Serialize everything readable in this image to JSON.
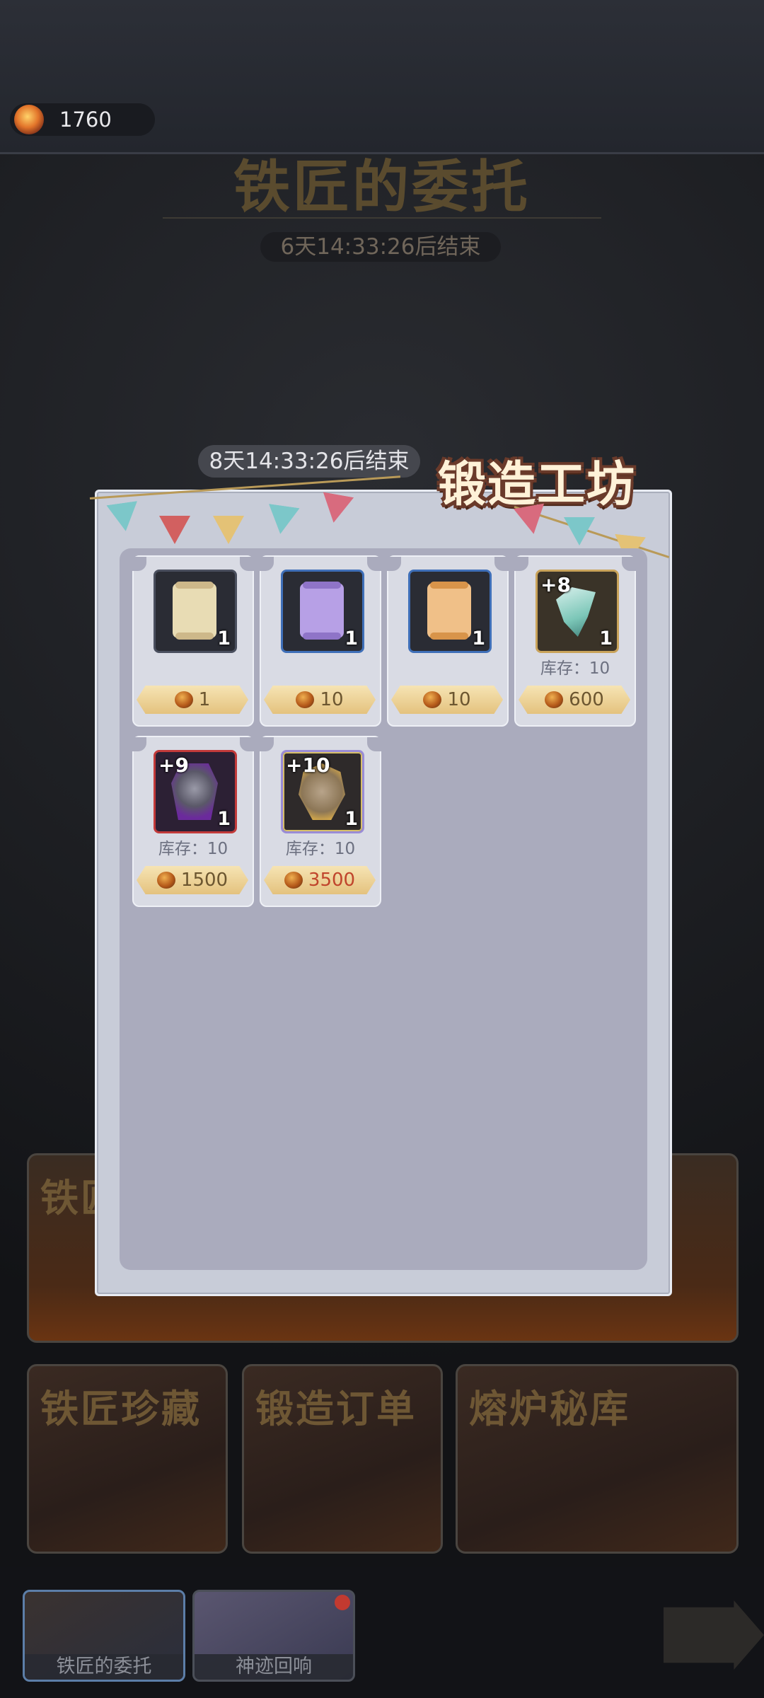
{
  "currency": {
    "amount": "1760",
    "icon": "ore-icon"
  },
  "background": {
    "title": "铁匠的委托",
    "timer": "6天14:33:26后结束",
    "banner_main": "铁匠",
    "banners": [
      "铁匠珍藏",
      "锻造订单",
      "熔炉秘库"
    ],
    "bottom_tabs": [
      "铁匠的委托",
      "神迹回响"
    ]
  },
  "forge": {
    "title": "锻造工坊",
    "timer": "8天14:33:26后结束",
    "items": [
      {
        "name": "white-scroll",
        "count": "1",
        "plus": "",
        "stock": "",
        "price": "1",
        "price_red": false
      },
      {
        "name": "purple-scroll",
        "count": "1",
        "plus": "",
        "stock": "",
        "price": "10",
        "price_red": false
      },
      {
        "name": "orange-scroll",
        "count": "1",
        "plus": "",
        "stock": "",
        "price": "10",
        "price_red": false
      },
      {
        "name": "teal-weapon",
        "count": "1",
        "plus": "+8",
        "stock": "库存：10",
        "price": "600",
        "price_red": false
      },
      {
        "name": "dark-armor",
        "count": "1",
        "plus": "+9",
        "stock": "库存：10",
        "price": "1500",
        "price_red": false
      },
      {
        "name": "gold-shield",
        "count": "1",
        "plus": "+10",
        "stock": "库存：10",
        "price": "3500",
        "price_red": true
      }
    ]
  },
  "colors": {
    "panel": "#c8ccd8",
    "panel_inner": "#aaabbd",
    "price_gold": "#e4c27e",
    "price_red_text": "#c0452c"
  }
}
